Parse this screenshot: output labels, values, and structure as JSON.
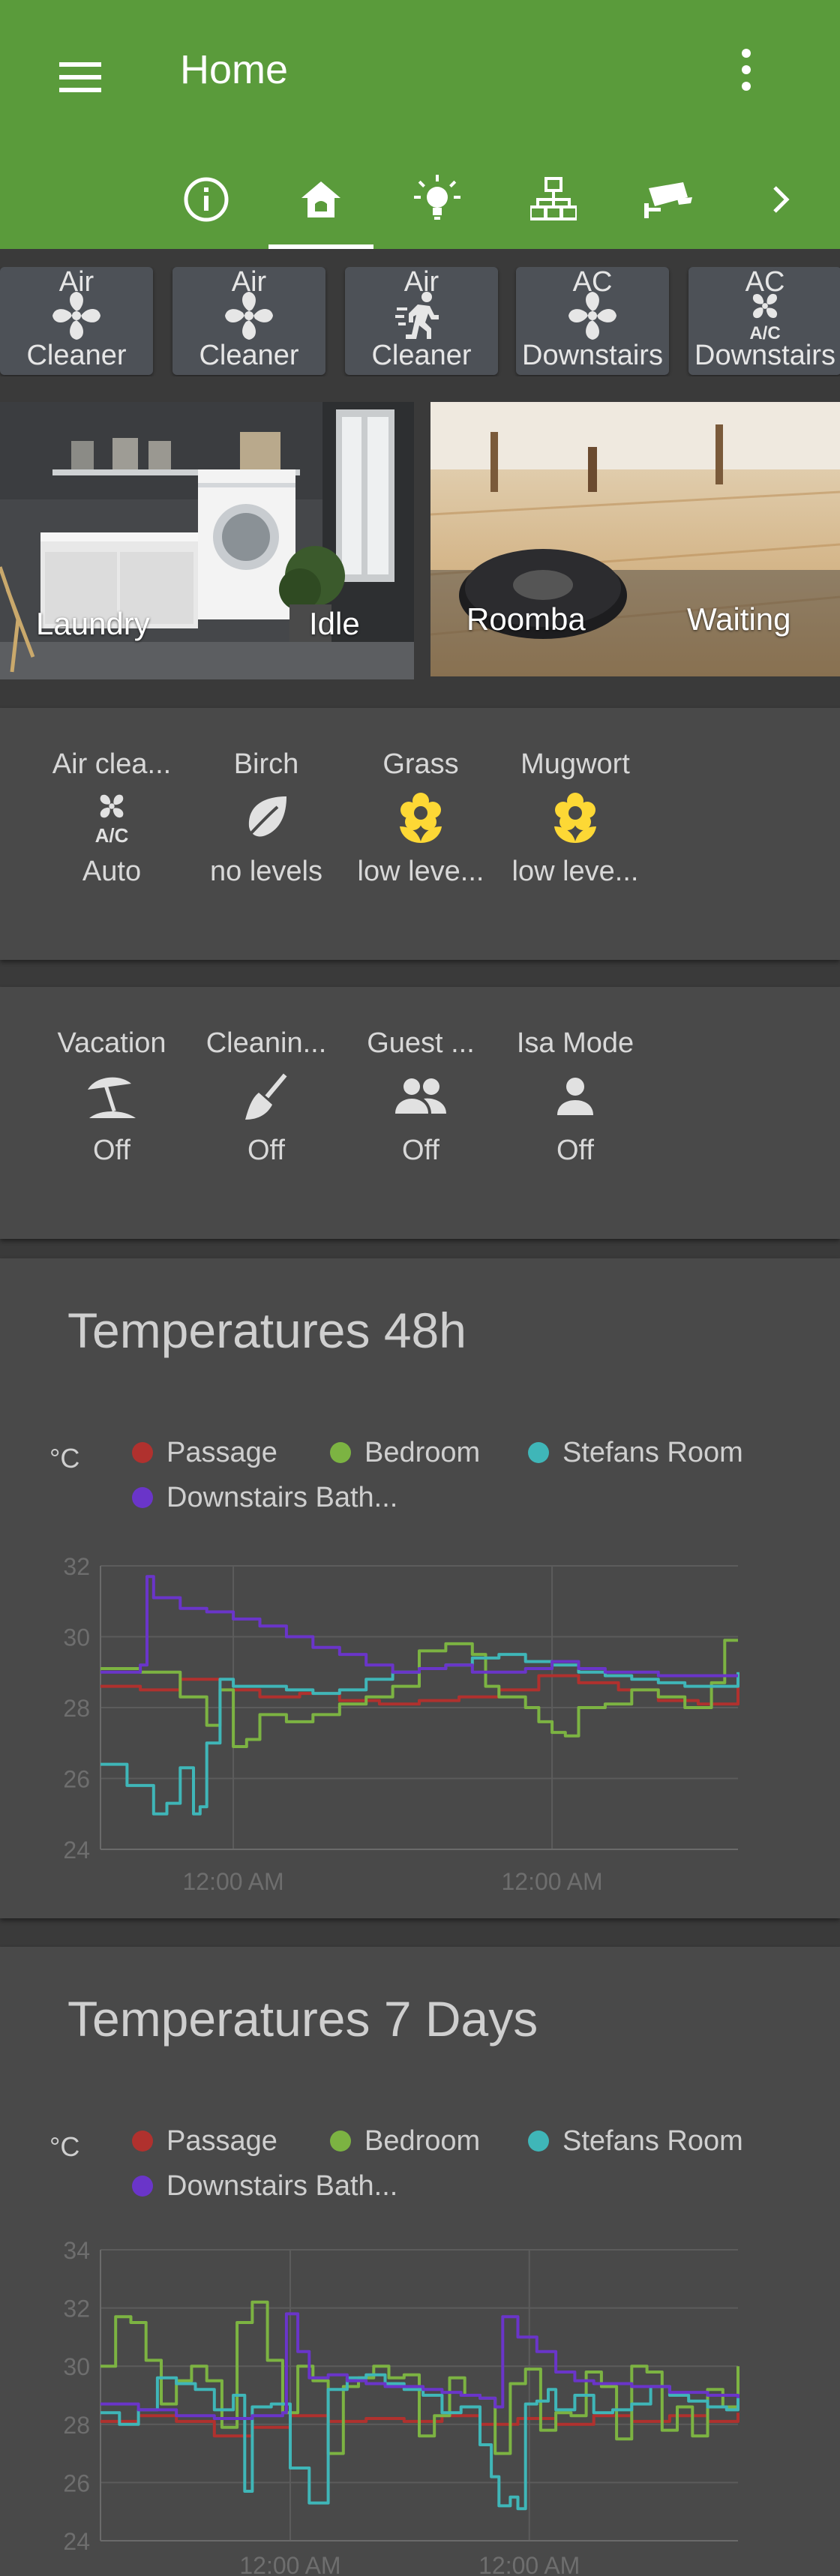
{
  "header": {
    "title": "Home",
    "color": "#5a9b3b",
    "tabs": [
      {
        "icon": "info-icon"
      },
      {
        "icon": "home-icon",
        "active": true
      },
      {
        "icon": "lightbulb-icon"
      },
      {
        "icon": "network-icon"
      },
      {
        "icon": "cctv-icon"
      },
      {
        "icon": "chevron-right-icon"
      }
    ]
  },
  "buttons": [
    {
      "top": "Air",
      "bottom": "Cleaner",
      "icon": "fan-icon"
    },
    {
      "top": "Air",
      "bottom": "Cleaner",
      "icon": "fan-icon"
    },
    {
      "top": "Air",
      "bottom": "Cleaner",
      "icon": "run-icon"
    },
    {
      "top": "AC",
      "bottom": "Downstairs",
      "icon": "fan-icon"
    },
    {
      "top": "AC",
      "bottom": "Downstairs",
      "icon": "air-conditioner-icon"
    }
  ],
  "pictures": [
    {
      "name": "Laundry",
      "state": "Idle"
    },
    {
      "name": "Roomba",
      "state": "Waiting"
    }
  ],
  "glance1": [
    {
      "name": "Air clea...",
      "state": "Auto",
      "icon": "air-conditioner-icon"
    },
    {
      "name": "Birch",
      "state": "no levels",
      "icon": "leaf-icon"
    },
    {
      "name": "Grass",
      "state": "low leve...",
      "icon": "flower-icon"
    },
    {
      "name": "Mugwort",
      "state": "low leve...",
      "icon": "flower-icon"
    }
  ],
  "glance2": [
    {
      "name": "Vacation",
      "state": "Off",
      "icon": "beach-icon"
    },
    {
      "name": "Cleanin...",
      "state": "Off",
      "icon": "broom-icon"
    },
    {
      "name": "Guest ...",
      "state": "Off",
      "icon": "account-multiple-icon"
    },
    {
      "name": "Isa Mode",
      "state": "Off",
      "icon": "account-icon"
    }
  ],
  "graph48": {
    "title": "Temperatures 48h",
    "unit": "°C"
  },
  "graph7": {
    "title": "Temperatures 7 Days",
    "unit": "°C"
  },
  "series_legend": [
    {
      "name": "Passage",
      "color": "#b0312e"
    },
    {
      "name": "Bedroom",
      "color": "#7cb342"
    },
    {
      "name": "Stefans Room",
      "color": "#3fb6b8"
    },
    {
      "name": "Downstairs Bath...",
      "color": "#6a35c9"
    }
  ],
  "chart_data": [
    {
      "type": "line",
      "title": "Temperatures 48h",
      "ylabel": "°C",
      "ylim": [
        24,
        32
      ],
      "yticks": [
        24,
        26,
        28,
        30,
        32
      ],
      "xticks": [
        "12:00 AM",
        "12:00 AM"
      ],
      "xlim": [
        0,
        48
      ],
      "xtick_pos": [
        10,
        34
      ],
      "series": [
        {
          "name": "Passage",
          "color": "#b0312e",
          "x": [
            0,
            3,
            6,
            9,
            12,
            15,
            18,
            21,
            24,
            27,
            30,
            33,
            36,
            39,
            42,
            45,
            48
          ],
          "y": [
            28.6,
            28.5,
            28.8,
            28.5,
            28.3,
            28.4,
            28.2,
            28.1,
            28.2,
            28.3,
            28.5,
            28.9,
            28.7,
            28.5,
            28.2,
            28.1,
            28.6
          ]
        },
        {
          "name": "Bedroom",
          "color": "#7cb342",
          "x": [
            0,
            3,
            6,
            8,
            9,
            10,
            11,
            12,
            14,
            16,
            18,
            20,
            22,
            24,
            26,
            28,
            29,
            30,
            32,
            33,
            34,
            35,
            36,
            38,
            40,
            42,
            44,
            46,
            47,
            48
          ],
          "y": [
            29.1,
            29.0,
            28.3,
            27.5,
            28.5,
            26.9,
            27.1,
            27.8,
            27.6,
            27.8,
            28.1,
            28.3,
            28.6,
            29.6,
            29.8,
            29.5,
            28.6,
            28.3,
            28.0,
            27.6,
            27.3,
            27.2,
            28.0,
            28.1,
            28.5,
            28.3,
            28.0,
            28.7,
            29.9,
            29.9
          ]
        },
        {
          "name": "Stefans Room",
          "color": "#3fb6b8",
          "x": [
            0,
            2,
            4,
            5,
            6,
            7,
            7.5,
            8,
            9,
            10,
            12,
            14,
            16,
            18,
            20,
            22,
            24,
            26,
            28,
            30,
            32,
            34,
            36,
            38,
            40,
            42,
            44,
            46,
            48
          ],
          "y": [
            26.4,
            25.8,
            25.0,
            25.3,
            26.3,
            25.0,
            25.2,
            27.0,
            28.8,
            28.6,
            28.6,
            28.5,
            28.4,
            28.5,
            28.8,
            29.0,
            29.1,
            29.2,
            29.4,
            29.5,
            29.3,
            29.2,
            29.0,
            28.9,
            28.8,
            28.7,
            28.6,
            28.6,
            29.0
          ]
        },
        {
          "name": "Downstairs Bath...",
          "color": "#6a35c9",
          "x": [
            0,
            2,
            3,
            3.5,
            4,
            6,
            8,
            10,
            12,
            14,
            16,
            18,
            20,
            22,
            24,
            26,
            28,
            30,
            32,
            34,
            36,
            38,
            40,
            42,
            44,
            46,
            48
          ],
          "y": [
            29.0,
            29.0,
            29.2,
            31.7,
            31.1,
            30.8,
            30.7,
            30.5,
            30.3,
            30.0,
            29.7,
            29.5,
            29.2,
            29.0,
            29.1,
            29.2,
            29.0,
            29.0,
            29.1,
            29.3,
            29.1,
            29.0,
            29.0,
            28.9,
            28.9,
            28.9,
            28.9
          ]
        }
      ]
    },
    {
      "type": "line",
      "title": "Temperatures 7 Days",
      "ylabel": "°C",
      "ylim": [
        24,
        34
      ],
      "yticks": [
        24,
        26,
        28,
        30,
        32,
        34
      ],
      "xticks": [
        "12:00 AM",
        "12:00 AM"
      ],
      "xlim": [
        0,
        168
      ],
      "xtick_pos": [
        50,
        113
      ],
      "series": [
        {
          "name": "Passage",
          "color": "#b0312e",
          "x": [
            0,
            10,
            20,
            30,
            40,
            50,
            60,
            70,
            80,
            90,
            100,
            110,
            120,
            130,
            140,
            150,
            160,
            168
          ],
          "y": [
            28.1,
            28.3,
            28.1,
            27.6,
            27.9,
            28.3,
            28.1,
            28.2,
            28.1,
            28.3,
            28.0,
            28.2,
            28.0,
            28.3,
            28.1,
            28.3,
            28.1,
            28.4
          ]
        },
        {
          "name": "Bedroom",
          "color": "#7cb342",
          "x": [
            0,
            4,
            8,
            12,
            16,
            20,
            24,
            28,
            32,
            36,
            40,
            44,
            48,
            52,
            56,
            60,
            64,
            68,
            72,
            76,
            80,
            84,
            88,
            92,
            96,
            100,
            104,
            108,
            112,
            116,
            120,
            124,
            128,
            132,
            136,
            140,
            144,
            148,
            152,
            156,
            160,
            164,
            168
          ],
          "y": [
            30,
            31.7,
            31.5,
            30.2,
            28.7,
            29.5,
            30.0,
            29.5,
            27.9,
            31.5,
            32.2,
            30.2,
            28.4,
            30.0,
            29.5,
            27.0,
            29.3,
            29.6,
            30.0,
            29.6,
            29.7,
            27.6,
            28.3,
            29.6,
            29.0,
            28.9,
            27.0,
            29.4,
            29.9,
            27.8,
            28.4,
            28.3,
            29.8,
            29.3,
            27.5,
            30.0,
            29.8,
            27.8,
            28.6,
            27.6,
            29.2,
            28.6,
            30.0
          ]
        },
        {
          "name": "Stefans Room",
          "color": "#3fb6b8",
          "x": [
            0,
            5,
            10,
            15,
            20,
            25,
            30,
            35,
            38,
            40,
            45,
            50,
            55,
            60,
            65,
            70,
            75,
            80,
            85,
            90,
            95,
            100,
            103,
            105,
            108,
            110,
            112,
            115,
            118,
            120,
            125,
            130,
            135,
            140,
            145,
            150,
            155,
            160,
            165,
            168
          ],
          "y": [
            28.4,
            28.0,
            28.5,
            29.6,
            29.4,
            29.2,
            28.5,
            29.0,
            25.7,
            28.6,
            28.7,
            26.5,
            25.3,
            29.2,
            29.6,
            29.7,
            29.4,
            29.2,
            29.0,
            28.4,
            28.6,
            27.3,
            26.2,
            25.2,
            25.5,
            25.1,
            28.7,
            28.8,
            29.2,
            28.5,
            29.0,
            28.4,
            28.5,
            28.7,
            29.3,
            29.0,
            28.8,
            28.6,
            28.5,
            29.0
          ]
        },
        {
          "name": "Downstairs Bath...",
          "color": "#6a35c9",
          "x": [
            0,
            10,
            20,
            30,
            40,
            48,
            49,
            52,
            55,
            60,
            65,
            70,
            75,
            80,
            85,
            90,
            95,
            100,
            104,
            106,
            110,
            115,
            120,
            125,
            130,
            140,
            150,
            160,
            168
          ],
          "y": [
            28.7,
            28.5,
            28.3,
            28.2,
            28.3,
            28.4,
            31.8,
            30.5,
            29.6,
            29.7,
            29.5,
            29.4,
            29.3,
            29.3,
            29.2,
            29.1,
            29.0,
            28.9,
            28.6,
            31.7,
            31.0,
            30.5,
            29.8,
            29.5,
            29.4,
            29.3,
            29.1,
            29.0,
            28.9
          ]
        }
      ]
    }
  ]
}
